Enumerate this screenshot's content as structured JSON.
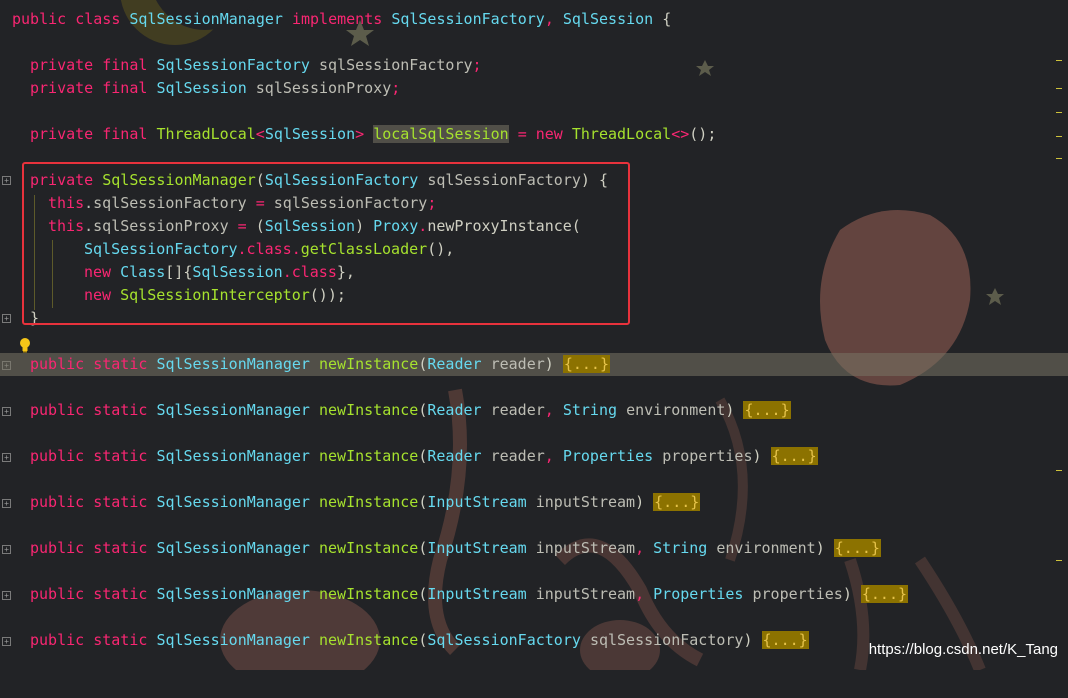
{
  "lines": {
    "l0": {
      "c1": "public",
      "c2": "class",
      "c3": "SqlSessionManager",
      "c4": "implements",
      "c5": "SqlSessionFactory",
      "c6": ",",
      "c7": "SqlSession",
      "c8": "{"
    },
    "l1": {
      "c1": "private",
      "c2": "final",
      "c3": "SqlSessionFactory",
      "c4": "sqlSessionFactory",
      "c5": ";"
    },
    "l2": {
      "c1": "private",
      "c2": "final",
      "c3": "SqlSession",
      "c4": "sqlSessionProxy",
      "c5": ";"
    },
    "l3": {
      "c1": "private",
      "c2": "final",
      "c3": "ThreadLocal",
      "c4": "<",
      "c5": "SqlSession",
      "c6": ">",
      "c7": "localSqlSession",
      "c8": "=",
      "c9": "new",
      "c10": "ThreadLocal",
      "c11": "<>",
      "c12": "();"
    },
    "l4": {
      "c1": "private",
      "c2": "SqlSessionManager",
      "c3": "(",
      "c4": "SqlSessionFactory",
      "c5": "sqlSessionFactory",
      "c6": ") {"
    },
    "l5": {
      "c1": "this",
      "c2": ".sqlSessionFactory",
      "c3": "=",
      "c4": "sqlSessionFactory",
      "c5": ";"
    },
    "l6": {
      "c1": "this",
      "c2": ".sqlSessionProxy",
      "c3": "=",
      "c4": "(",
      "c5": "SqlSession",
      "c6": ")",
      "c7": "Proxy",
      "c8": ".",
      "c9": "newProxyInstance("
    },
    "l7": {
      "c1": "SqlSessionFactory",
      ".class": ".class",
      ".": ".",
      "c3": "getClassLoader",
      "c4": "(),"
    },
    "l8": {
      "c1": "new",
      "c2": "Class",
      "c3": "[]{",
      "c4": "SqlSession",
      "c5": ".class",
      "c6": "},"
    },
    "l9": {
      "c1": "new",
      "c2": "SqlSessionInterceptor",
      "c3": "());"
    },
    "l10": {
      "c1": "}"
    },
    "m1": {
      "c1": "public",
      "c2": "static",
      "c3": "SqlSessionManager",
      "c4": "newInstance",
      "c5": "(",
      "c6": "Reader",
      "c7": "reader",
      ")": ")",
      "fold": "{...}"
    },
    "m2": {
      "c1": "public",
      "c2": "static",
      "c3": "SqlSessionManager",
      "c4": "newInstance",
      "c5": "(",
      "c6": "Reader",
      "c7": "reader",
      "c8": ",",
      "c9": "String",
      "c10": "environment",
      ")": ")",
      "fold": "{...}"
    },
    "m3": {
      "c1": "public",
      "c2": "static",
      "c3": "SqlSessionManager",
      "c4": "newInstance",
      "c5": "(",
      "c6": "Reader",
      "c7": "reader",
      "c8": ",",
      "c9": "Properties",
      "c10": "properties",
      ")": ")",
      "fold": "{...}"
    },
    "m4": {
      "c1": "public",
      "c2": "static",
      "c3": "SqlSessionManager",
      "c4": "newInstance",
      "c5": "(",
      "c6": "InputStream",
      "c7": "inputStream",
      ")": ")",
      "fold": "{...}"
    },
    "m5": {
      "c1": "public",
      "c2": "static",
      "c3": "SqlSessionManager",
      "c4": "newInstance",
      "c5": "(",
      "c6": "InputStream",
      "c7": "inputStream",
      "c8": ",",
      "c9": "String",
      "c10": "environment",
      ")": ")",
      "fold": "{...}"
    },
    "m6": {
      "c1": "public",
      "c2": "static",
      "c3": "SqlSessionManager",
      "c4": "newInstance",
      "c5": "(",
      "c6": "InputStream",
      "c7": "inputStream",
      "c8": ",",
      "c9": "Properties",
      "c10": "properties",
      ")": ")",
      "fold": "{...}"
    },
    "m7": {
      "c1": "public",
      "c2": "static",
      "c3": "SqlSessionManager",
      "c4": "newInstance",
      "c5": "(",
      "c6": "SqlSessionFactory",
      "c7": "sqlSessionFactory",
      ")": ")",
      "fold": "{...}"
    }
  },
  "watermark": "https://blog.csdn.net/K_Tang",
  "colors": {
    "keyword": "#f92672",
    "type": "#66d9ef",
    "method": "#a6e22e",
    "fold_bg": "#8c7200",
    "highlight_box": "#e8323c"
  },
  "icons": {
    "bulb": "lightbulb-icon",
    "fold": "fold-marker-icon"
  }
}
